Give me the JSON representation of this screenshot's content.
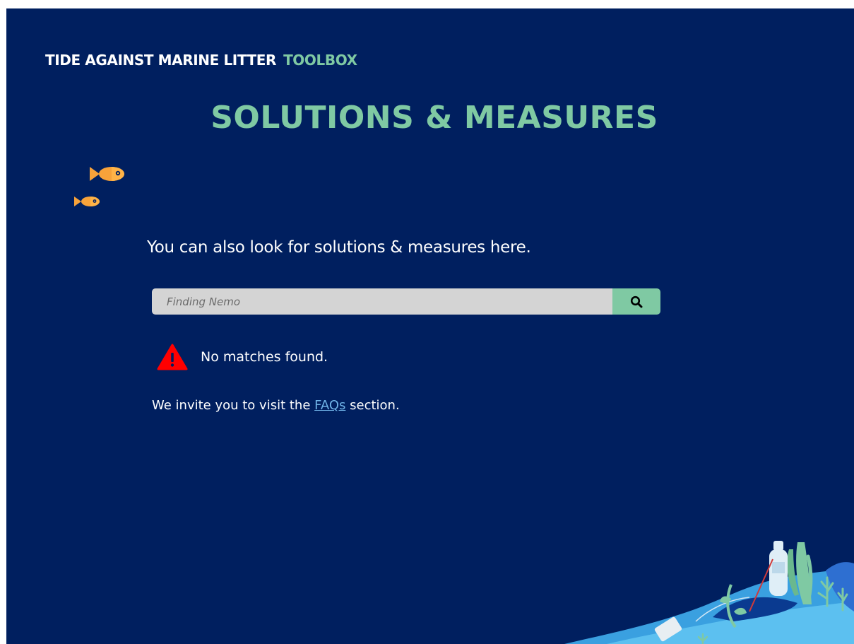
{
  "header": {
    "brand_main": "TIDE AGAINST MARINE LITTER",
    "brand_accent": "TOOLBOX"
  },
  "page_title": "SOLUTIONS & MEASURES",
  "intro_text": "You can also look for solutions & measures here.",
  "search": {
    "value": "Finding Nemo",
    "placeholder": "Finding Nemo",
    "button_icon": "search-icon"
  },
  "alert": {
    "icon": "warning-icon",
    "message": "No matches found."
  },
  "invite": {
    "before": "We invite you to visit the",
    "link_text": "FAQs",
    "after": "section."
  },
  "colors": {
    "background": "#001f5f",
    "accent": "#7fc9a3",
    "link": "#6fb3e8",
    "warning": "#ff0000",
    "fish": "#f7a23a"
  }
}
